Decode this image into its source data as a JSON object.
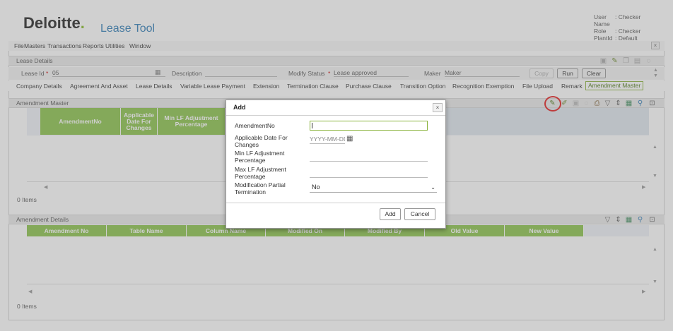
{
  "header": {
    "logo_text": "Deloitte",
    "logo_dot": ".",
    "app_title": "Lease Tool",
    "user": [
      {
        "k": "User Name",
        "v": ": Checker"
      },
      {
        "k": "Role",
        "v": ": Checker"
      },
      {
        "k": "PlantId",
        "v": ": Default"
      }
    ]
  },
  "menubar": {
    "items": [
      "File",
      "Masters",
      "Transactions",
      "Reports",
      "Utilities",
      "Window"
    ],
    "close": "×"
  },
  "lease_details": {
    "title": "Lease Details",
    "lease_id_label": "Lease Id",
    "lease_id_required": "*",
    "lease_id_value": "05",
    "description_label": "Description",
    "modify_status_label": "Modify Status",
    "modify_status_value": "Lease approved",
    "maker_label": "Maker",
    "maker_value": "Maker",
    "copy_label": "Copy",
    "run_label": "Run",
    "clear_label": "Clear"
  },
  "tabs": [
    "Company Details",
    "Agreement And Asset",
    "Lease Details",
    "Variable Lease Payment",
    "Extension",
    "Termination Clause",
    "Purchase Clause",
    "Transition Option",
    "Recognition Exemption",
    "File Upload",
    "Remark",
    "Amendment Master"
  ],
  "amendment_master": {
    "title": "Amendment Master",
    "columns": [
      "AmendmentNo",
      "Applicable Date For Changes",
      "Min LF Adjustment Percentage"
    ],
    "items_label": "0  Items"
  },
  "amendment_details": {
    "title": "Amendment Details",
    "columns": [
      "Amendment No",
      "Table Name",
      "Column Name",
      "Modified On",
      "Modified By",
      "Old Value",
      "New Value"
    ],
    "items_label": "0  Items"
  },
  "modal": {
    "title": "Add",
    "close": "×",
    "fields": [
      {
        "label": "AmendmentNo",
        "value": ""
      },
      {
        "label": "Applicable Date For Changes",
        "placeholder": "YYYY-MM-DD"
      },
      {
        "label": "Min LF Adjustment Percentage",
        "value": ""
      },
      {
        "label": "Max LF Adjustment Percentage",
        "value": ""
      },
      {
        "label": "Modification Partial Termination",
        "value": "No"
      }
    ],
    "add_label": "Add",
    "cancel_label": "Cancel"
  },
  "colors": {
    "accent_green": "#8bc34a",
    "title_blue": "#2d7bb6",
    "highlight_red": "#e31d1d"
  }
}
